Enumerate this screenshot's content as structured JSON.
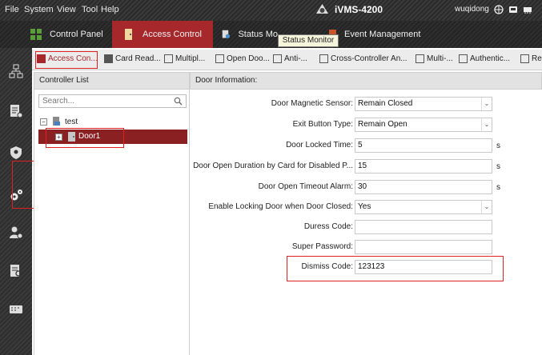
{
  "menu": [
    "File",
    "System",
    "View",
    "Tool",
    "Help"
  ],
  "app": {
    "title": "iVMS-4200",
    "username": "wuqidong"
  },
  "modules": [
    {
      "label": "Control Panel",
      "icon": "control-panel-icon"
    },
    {
      "label": "Access Control",
      "icon": "access-control-icon",
      "active": true
    },
    {
      "label": "Status Mo",
      "icon": "status-monitor-icon"
    },
    {
      "label": "Event Management",
      "icon": "event-management-icon"
    }
  ],
  "tooltip": "Status Monitor",
  "subtabs": [
    {
      "label": "Access Con...",
      "icon": "access-control-tab-icon",
      "active": true
    },
    {
      "label": "Card Read...",
      "icon": "card-reader-icon"
    },
    {
      "label": "Multipl...",
      "icon": "multiple-icon"
    },
    {
      "label": "Open Doo...",
      "icon": "open-door-icon"
    },
    {
      "label": "Anti-...",
      "icon": "anti-passback-icon"
    },
    {
      "label": "Cross-Controller An...",
      "icon": "cross-controller-icon"
    },
    {
      "label": "Multi-...",
      "icon": "multi-door-icon"
    },
    {
      "label": "Authentic...",
      "icon": "authentication-icon"
    },
    {
      "label": "Re",
      "icon": "re-icon"
    }
  ],
  "controller": {
    "title": "Controller List",
    "search_placeholder": "Search...",
    "tree": {
      "root": "test",
      "child": "Door1"
    }
  },
  "door": {
    "title": "Door Information:",
    "fields": [
      {
        "label": "Door Magnetic Sensor:",
        "value": "Remain Closed",
        "type": "select"
      },
      {
        "label": "Exit Button Type:",
        "value": "Remain Open",
        "type": "select"
      },
      {
        "label": "Door Locked Time:",
        "value": "5",
        "type": "text",
        "unit": "s"
      },
      {
        "label": "Door Open Duration by Card for Disabled P...",
        "value": "15",
        "type": "text",
        "unit": "s"
      },
      {
        "label": "Door Open Timeout Alarm:",
        "value": "30",
        "type": "text",
        "unit": "s"
      },
      {
        "label": "Enable Locking Door when Door Closed:",
        "value": "Yes",
        "type": "select"
      },
      {
        "label": "Duress Code:",
        "value": "",
        "type": "text"
      },
      {
        "label": "Super Password:",
        "value": "",
        "type": "text"
      },
      {
        "label": "Dismiss Code:",
        "value": "123123",
        "type": "text"
      }
    ]
  },
  "colors": {
    "accent": "#a7282b",
    "highlight_box": "#e02020",
    "selected_row": "#8b2023"
  }
}
